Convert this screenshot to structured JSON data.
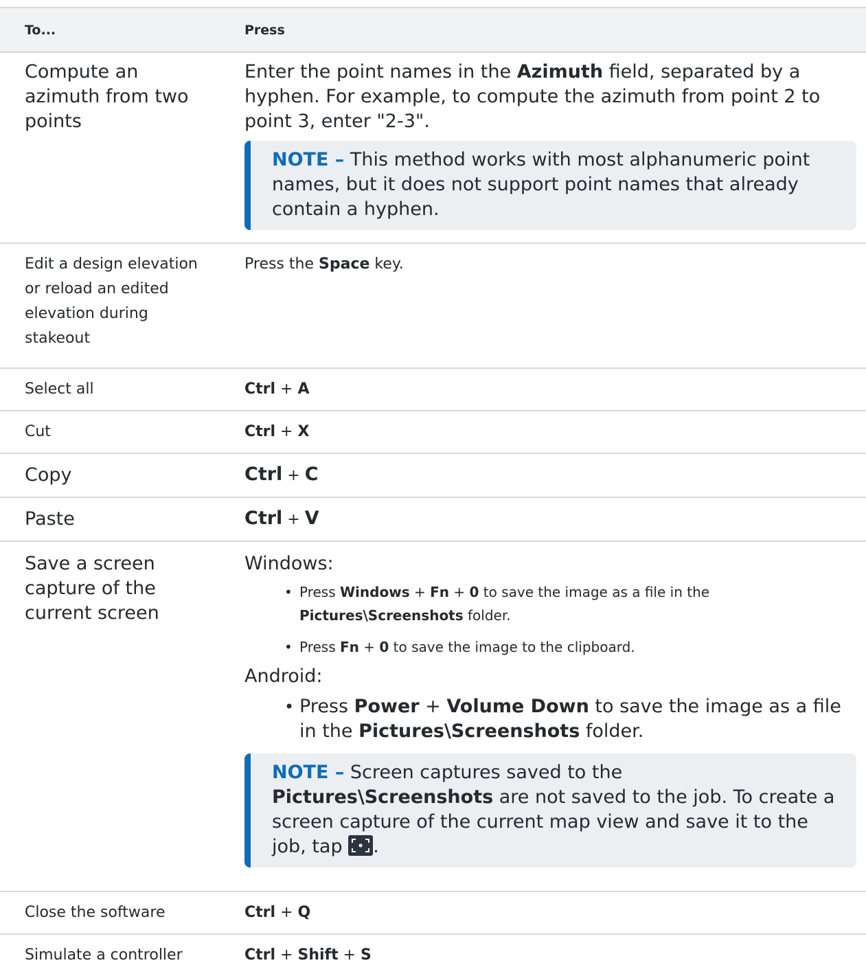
{
  "header": {
    "col1": "To...",
    "col2": "Press"
  },
  "rows": {
    "azimuth": {
      "task": "Compute an azimuth from two points",
      "p1": "Enter the point names in the ",
      "b1": "Azimuth",
      "p2": " field, separated by a hyphen. For example, to compute the azimuth from point 2 to point 3, enter \"2-3\".",
      "note_label": "NOTE –",
      "note_text": " This method works with most alphanumeric point names, but it does not support point names that already contain a hyphen."
    },
    "design_elev": {
      "task": "Edit a design elevation or reload an edited elevation during stakeout",
      "p1": "Press the ",
      "b1": "Space",
      "p2": " key."
    },
    "select_all": {
      "task": "Select all",
      "k1": "Ctrl",
      "plus": " + ",
      "k2": "A"
    },
    "cut": {
      "task": "Cut",
      "k1": "Ctrl",
      "plus": " + ",
      "k2": "X"
    },
    "copy": {
      "task": "Copy",
      "k1": "Ctrl",
      "plus": " + ",
      "k2": "C"
    },
    "paste": {
      "task": "Paste",
      "k1": "Ctrl",
      "plus": " + ",
      "k2": "V"
    },
    "screen_capture": {
      "task": "Save a screen capture of the current screen",
      "windows_label": "Windows:",
      "w1_p1": "Press ",
      "w1_b1": "Windows",
      "w1_plus1": " + ",
      "w1_b2": "Fn",
      "w1_plus2": " + ",
      "w1_b3": "0",
      "w1_p2": " to save the image as a file in the ",
      "w1_b4": "Pictures\\Screenshots",
      "w1_p3": " folder.",
      "w2_p1": "Press ",
      "w2_b1": "Fn",
      "w2_plus": " + ",
      "w2_b2": "0",
      "w2_p2": " to save the image to the clipboard.",
      "android_label": "Android:",
      "a1_p1": "Press ",
      "a1_b1": "Power",
      "a1_plus": " + ",
      "a1_b2": "Volume Down",
      "a1_p2": " to save the image as a file in the ",
      "a1_b3": "Pictures\\Screenshots",
      "a1_p3": " folder.",
      "note_label": "NOTE –",
      "note_p1": " Screen captures saved to the ",
      "note_b1": "Pictures\\Screenshots",
      "note_p2": " are not saved to the job. To create a screen capture of the current map view and save it to the job, tap ",
      "note_p3": ".",
      "icon": "screen-capture-icon"
    },
    "close": {
      "task": "Close the software",
      "k1": "Ctrl",
      "plus": " + ",
      "k2": "Q"
    },
    "simulate": {
      "task": "Simulate a controller",
      "k1": "Ctrl",
      "plus1": " + ",
      "k2": "Shift",
      "plus2": " + ",
      "k3": "S"
    }
  },
  "colors": {
    "note_accent": "#0e6db5",
    "note_bg": "#eceff2",
    "border": "#d7d9dc",
    "header_bg": "#f1f2f4"
  }
}
